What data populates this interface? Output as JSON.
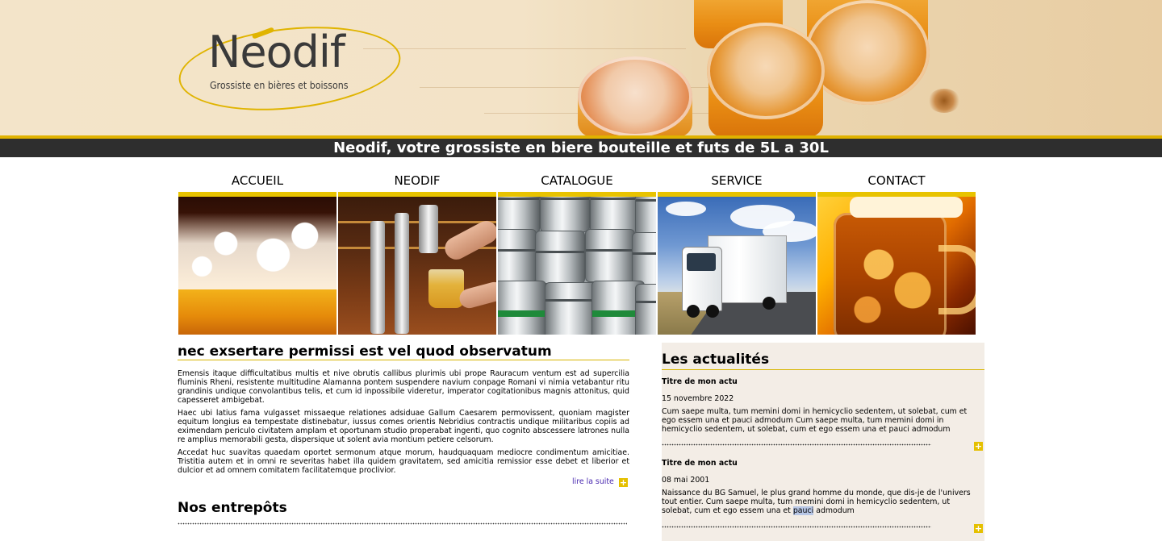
{
  "brand": {
    "name": "Neodif",
    "tagline": "Grossiste en bières et boissons"
  },
  "banner": {
    "headline": "Neodif, votre grossiste en biere bouteille et futs de 5L a 30L"
  },
  "nav": {
    "items": [
      {
        "label": "ACCUEIL",
        "image": "beer-glass-photo"
      },
      {
        "label": "NEODIF",
        "image": "beer-tap-photo"
      },
      {
        "label": "CATALOGUE",
        "image": "kegs-photo"
      },
      {
        "label": "SERVICE",
        "image": "truck-photo"
      },
      {
        "label": "CONTACT",
        "image": "beer-mug-photo"
      }
    ]
  },
  "main": {
    "title": "nec exsertare permissi est vel quod observatum",
    "paragraphs": [
      "Emensis itaque difficultatibus multis et nive obrutis callibus plurimis ubi prope Rauracum ventum est ad supercilia fluminis Rheni, resistente multitudine Alamanna pontem suspendere navium conpage Romani vi nimia vetabantur ritu grandinis undique convolantibus telis, et cum id inpossibile videretur, imperator cogitationibus magnis attonitus, quid capesseret ambigebat.",
      "Haec ubi latius fama vulgasset missaeque relationes adsiduae Gallum Caesarem permovissent, quoniam magister equitum longius ea tempestate distinebatur, iussus comes orientis Nebridius contractis undique militaribus copiis ad eximendam periculo civitatem amplam et oportunam studio properabat ingenti, quo cognito abscessere latrones nulla re amplius memorabili gesta, dispersique ut solent avia montium petiere celsorum.",
      "Accedat huc suavitas quaedam oportet sermonum atque morum, haudquaquam mediocre condimentum amicitiae. Tristitia autem et in omni re severitas habet illa quidem gravitatem, sed amicitia remissior esse debet et liberior et dulcior et ad omnem comitatem facilitatemque proclivior."
    ],
    "read_more": "lire la suite",
    "warehouses_title": "Nos entrepôts"
  },
  "news": {
    "title": "Les actualités",
    "items": [
      {
        "title": "Titre de mon actu",
        "date": "15 novembre 2022",
        "body": "Cum saepe multa, tum memini domi in hemicyclio sedentem, ut solebat, cum et ego essem una et pauci admodum Cum saepe multa, tum memini domi in hemicyclio sedentem, ut solebat, cum et ego essem una et pauci admodum"
      },
      {
        "title": "Titre de mon actu",
        "date": "08 mai 2001",
        "body_before": "Naissance du BG Samuel, le plus grand homme du monde, que dis-je de l'univers tout entier. Cum saepe multa, tum memini domi in hemicyclio sedentem, ut solebat, cum et ego essem una et ",
        "body_highlight": "pauci",
        "body_after": " admodum"
      }
    ],
    "more_symbol": "+"
  },
  "colors": {
    "accent_gold": "#e5c000",
    "tagline_bar": "#2e2e2e",
    "sidebar_bg": "#f3ede6",
    "link": "#4a2ab0"
  }
}
